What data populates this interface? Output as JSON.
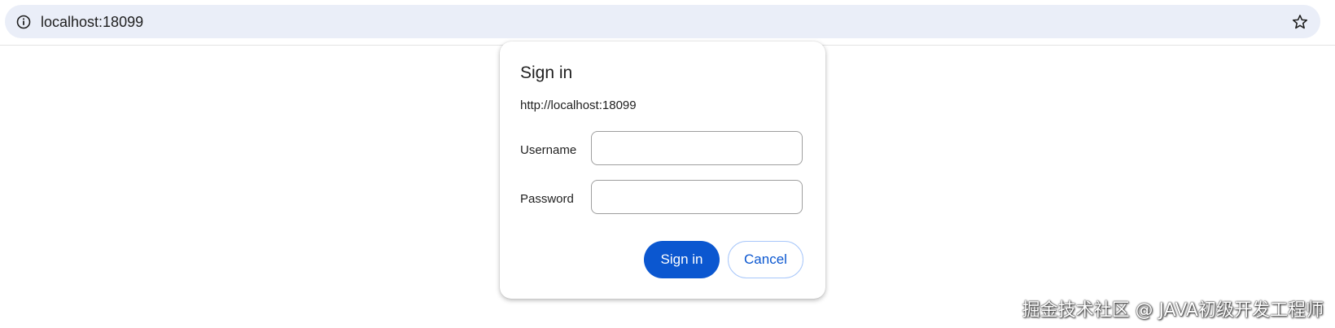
{
  "browser": {
    "address_bar": {
      "url": "localhost:18099",
      "info_icon": "info-circle-icon",
      "bookmark_icon": "star-outline-icon"
    },
    "omnibox_color": "#eaeef8"
  },
  "dialog": {
    "title": "Sign in",
    "origin": "http://localhost:18099",
    "fields": {
      "username": {
        "label": "Username",
        "value": "",
        "placeholder": ""
      },
      "password": {
        "label": "Password",
        "value": "",
        "placeholder": ""
      }
    },
    "buttons": {
      "sign_in": "Sign in",
      "cancel": "Cancel"
    },
    "colors": {
      "primary": "#0b57d0",
      "cancel_border": "#a8c7fa"
    }
  },
  "watermark": {
    "text": "掘金技术社区 @ JAVA初级开发工程师"
  }
}
